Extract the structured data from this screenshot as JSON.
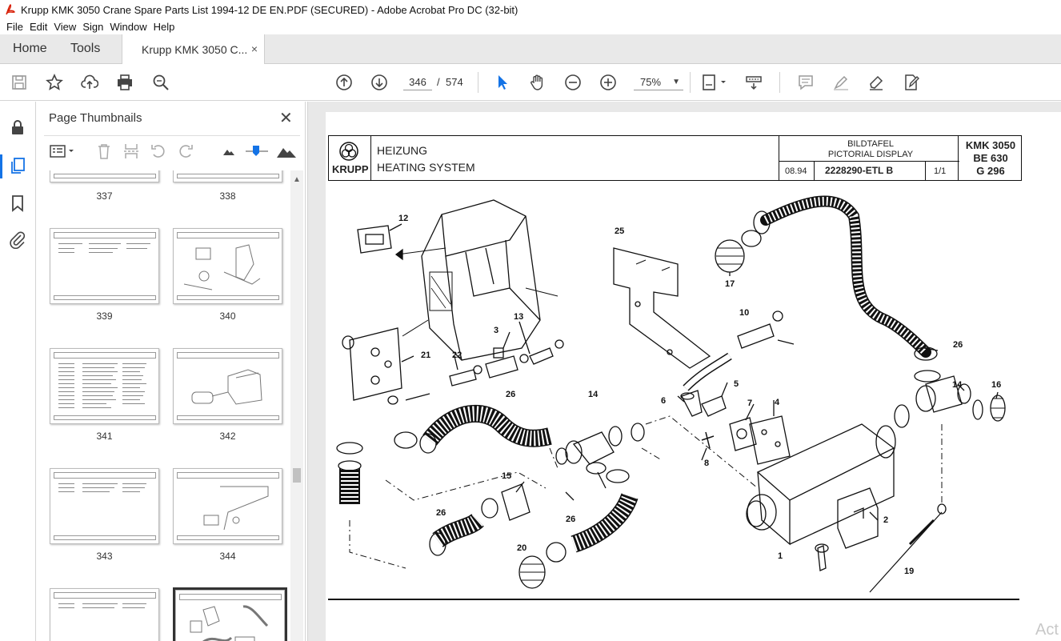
{
  "window": {
    "title": "Krupp KMK 3050 Crane Spare Parts List 1994-12 DE EN.PDF (SECURED) - Adobe Acrobat Pro DC (32-bit)"
  },
  "menu": [
    "File",
    "Edit",
    "View",
    "Sign",
    "Window",
    "Help"
  ],
  "tabs": {
    "home": "Home",
    "tools": "Tools",
    "document": "Krupp KMK 3050 C...",
    "close": "×"
  },
  "toolbar": {
    "page_current": "346",
    "page_sep": "/",
    "page_total": "574",
    "zoom": "75%"
  },
  "panel": {
    "title": "Page Thumbnails",
    "close": "✕",
    "thumbnails": [
      "337",
      "338",
      "339",
      "340",
      "341",
      "342",
      "343",
      "344"
    ],
    "selected_page": "346"
  },
  "document": {
    "brand": "KRUPP",
    "title_de": "HEIZUNG",
    "title_en": "HEATING SYSTEM",
    "bildtafel": "BILDTAFEL",
    "pictorial": "PICTORIAL DISPLAY",
    "date": "08.94",
    "drawing_no": "2228290-ETL  B",
    "sheet": "1/1",
    "model1": "KMK 3050",
    "model2": "BE 630",
    "model3": "G 296",
    "callouts": [
      "12",
      "25",
      "17",
      "10",
      "26",
      "13",
      "3",
      "21",
      "22",
      "14",
      "16",
      "5",
      "26",
      "6",
      "7",
      "4",
      "8",
      "15",
      "26",
      "26",
      "2",
      "20",
      "1",
      "19"
    ]
  },
  "watermark": "Act"
}
